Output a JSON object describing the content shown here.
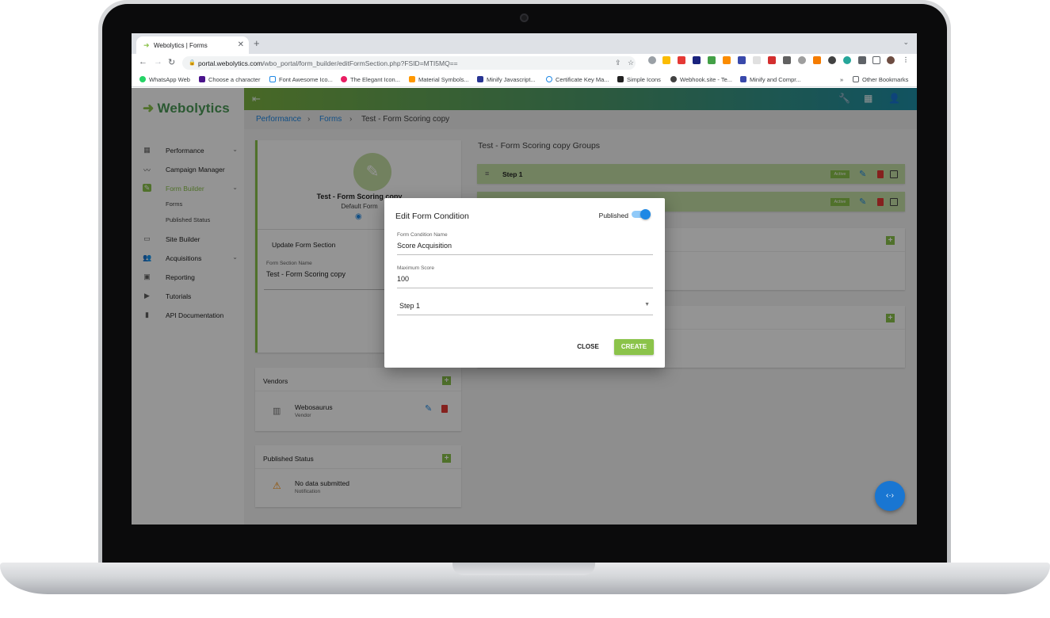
{
  "browser": {
    "tab_title": "Webolytics | Forms",
    "url_host": "portal.webolytics.com",
    "url_path": "/wbo_portal/form_builder/editFormSection.php?FSID=MTI5MQ==",
    "bookmarks": [
      "WhatsApp Web",
      "Choose a character",
      "Font Awesome Ico...",
      "The Elegant Icon...",
      "Material Symbols...",
      "Minify Javascript...",
      "Certificate Key Ma...",
      "Simple Icons",
      "Webhook.site - Te...",
      "Minify and Compr..."
    ],
    "more_bookmarks": "»",
    "other_bookmarks": "Other Bookmarks"
  },
  "app": {
    "logo": "Webolytics",
    "nav": [
      {
        "label": "Performance",
        "icon": "dashboard-icon"
      },
      {
        "label": "Campaign Manager",
        "icon": "chart-line-icon"
      },
      {
        "label": "Form Builder",
        "icon": "edit-form-icon"
      },
      {
        "label": "Site Builder",
        "icon": "browser-window-icon"
      },
      {
        "label": "Acquisitions",
        "icon": "people-icon"
      },
      {
        "label": "Reporting",
        "icon": "report-icon"
      },
      {
        "label": "Tutorials",
        "icon": "video-icon"
      },
      {
        "label": "API Documentation",
        "icon": "book-icon"
      }
    ],
    "form_builder_sub": [
      "Forms",
      "Published Status"
    ],
    "breadcrumb": [
      "Performance",
      "Forms",
      "Test - Form Scoring copy"
    ]
  },
  "left": {
    "form_name": "Test - Form Scoring copy",
    "form_type": "Default Form",
    "update_title": "Update Form Section",
    "section_label": "Form Section Name",
    "section_value": "Test - Form Scoring copy",
    "vendors_title": "Vendors",
    "vendor_name": "Webosaurus",
    "vendor_sub": "Vendor",
    "published_title": "Published Status",
    "no_data": "No data submitted",
    "notification": "Notification"
  },
  "right": {
    "groups_title": "Test - Form Scoring copy Groups",
    "step_label": "Step 1",
    "active_badge": "Active"
  },
  "dialog": {
    "title": "Edit Form Condition",
    "published_label": "Published",
    "published": true,
    "name_label": "Form Condition Name",
    "name_value": "Score Acquisition",
    "score_label": "Maximum Score",
    "score_value": "100",
    "step_value": "Step 1",
    "close_label": "CLOSE",
    "create_label": "CREATE"
  },
  "colors": {
    "brand_green": "#8bc34a",
    "accent_blue": "#1e88e5",
    "delete_red": "#e53935"
  }
}
